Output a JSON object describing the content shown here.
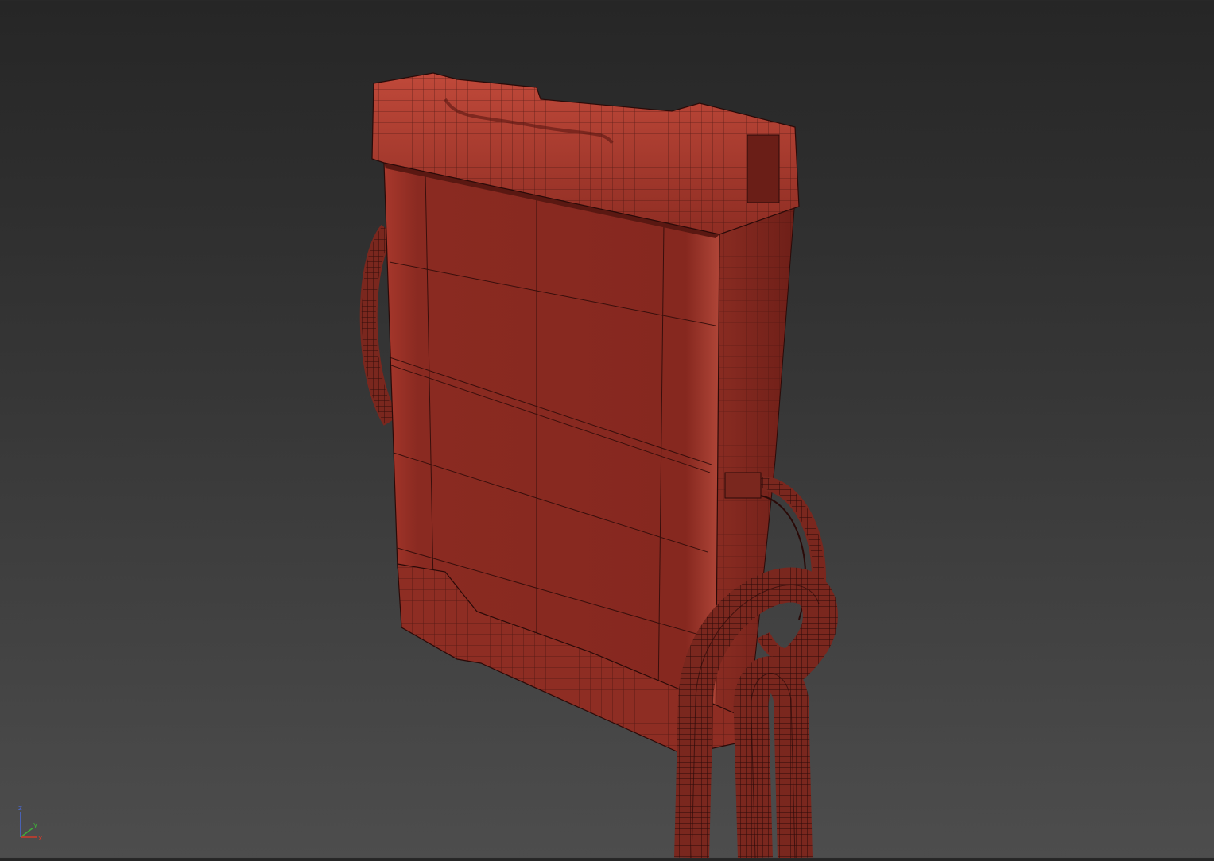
{
  "viewport": {
    "background_top": "#262626",
    "background_bottom": "#4d4d4d"
  },
  "model": {
    "body_color": "#8c2a22",
    "wire_color": "#2a0a08"
  },
  "axis_gizmo": {
    "z_label": "z",
    "y_label": "y",
    "x_label": "x",
    "x_color": "#d23b2a",
    "y_color": "#3fae3a",
    "z_color": "#4a6ad8"
  }
}
